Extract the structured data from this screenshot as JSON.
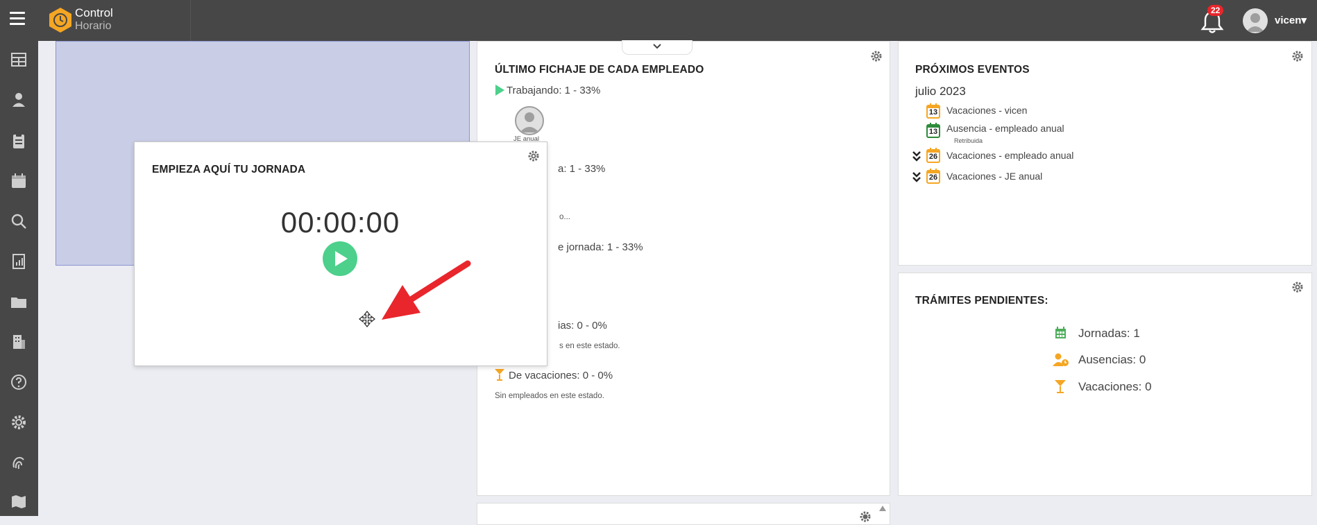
{
  "header": {
    "brand_line1": "Control",
    "brand_line2": "Horario",
    "notification_count": "22",
    "username": "vicen▾"
  },
  "sidebar": {
    "icons": [
      "dashboard-icon",
      "user-icon",
      "clipboard-icon",
      "calendar-icon",
      "search-icon",
      "report-icon",
      "folder-icon",
      "building-icon",
      "help-icon",
      "settings-icon",
      "fingerprint-icon",
      "map-icon"
    ]
  },
  "timer_panel": {
    "title": "EMPIEZA AQUÍ TU JORNADA",
    "time": "00:00:00"
  },
  "fichaje_panel": {
    "title": "ÚLTIMO FICHAJE DE CADA EMPLEADO",
    "working": "Trabajando: 1 - 33%",
    "employee_name": "JE anual",
    "row2": "a: 1 - 33%",
    "row3": "o...",
    "row4": "e jornada: 1 - 33%",
    "row5": "ias: 0 - 0%",
    "row5_note": "s en este estado.",
    "vacations": "De vacaciones: 0 - 0%",
    "vacations_note": "Sin empleados en este estado."
  },
  "eventos_panel": {
    "title": "PRÓXIMOS EVENTOS",
    "month": "julio 2023",
    "events": [
      {
        "day": "13",
        "label": "Vacaciones - vicen"
      },
      {
        "day": "13",
        "label": "Ausencia - empleado anual",
        "sub": "Retribuida"
      },
      {
        "day": "26",
        "label": "Vacaciones - empleado anual"
      },
      {
        "day": "26",
        "label": "Vacaciones - JE anual"
      }
    ]
  },
  "tramites_panel": {
    "title": "TRÁMITES PENDIENTES:",
    "items": [
      {
        "label": "Jornadas: 1"
      },
      {
        "label": "Ausencias: 0"
      },
      {
        "label": "Vacaciones: 0"
      }
    ]
  },
  "colors": {
    "topbar": "#474747",
    "accent_orange": "#f5a623",
    "play_green": "#4cd08b",
    "arrow_red": "#e8262c"
  }
}
